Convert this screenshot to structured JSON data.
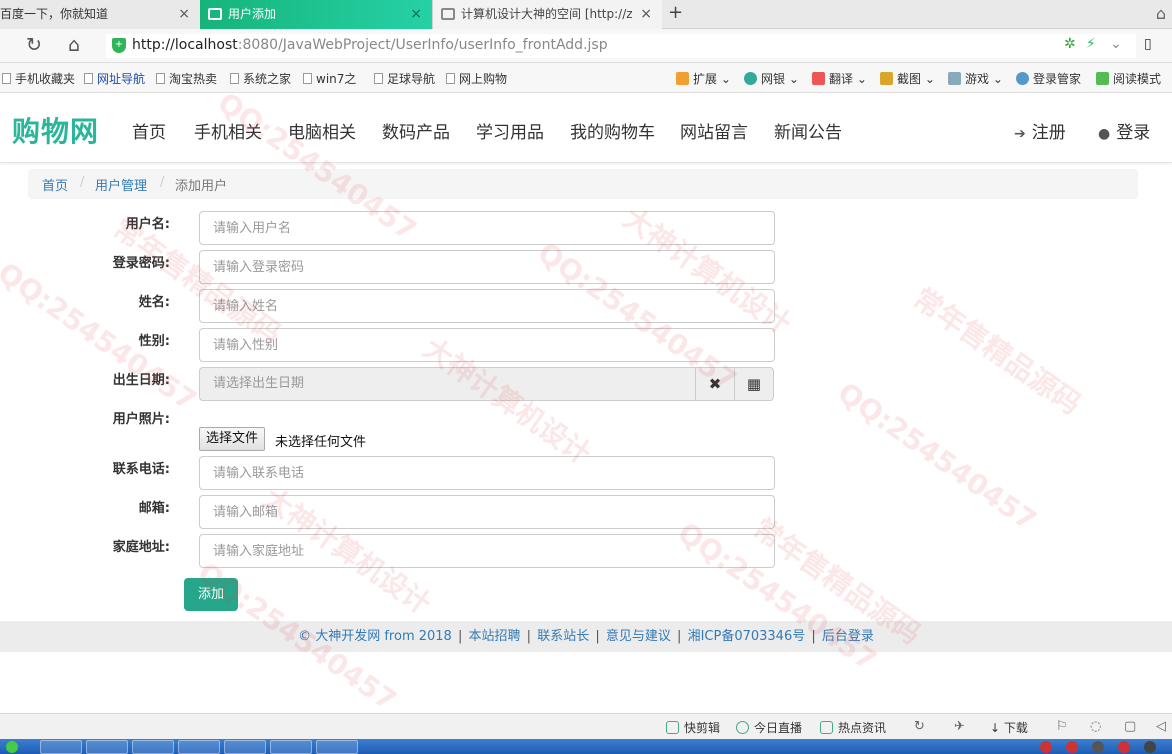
{
  "browser": {
    "tabs": [
      {
        "title": "百度一下，你就知道",
        "close": "×"
      },
      {
        "title": "用户添加",
        "close": "×"
      },
      {
        "title": "计算机设计大神的空间 [http://z",
        "close": "×"
      }
    ],
    "new_tab": "+",
    "url_host": "http://localhost",
    "url_rest": ":8080/JavaWebProject/UserInfo/userInfo_frontAdd.jsp",
    "bookmarks": [
      "手机收藏夹",
      "网址导航",
      "淘宝热卖",
      "系统之家",
      "win7之",
      "足球导航",
      "网上购物"
    ],
    "bookmark_tools": [
      "扩展",
      "网银",
      "翻译",
      "截图",
      "游戏",
      "登录管家",
      "阅读模式"
    ]
  },
  "site": {
    "logo": "购物网",
    "nav": [
      "首页",
      "手机相关",
      "电脑相关",
      "数码产品",
      "学习用品",
      "我的购物车",
      "网站留言",
      "新闻公告"
    ],
    "register": "注册",
    "login": "登录"
  },
  "breadcrumb": {
    "home": "首页",
    "section": "用户管理",
    "current": "添加用户",
    "sep": "/"
  },
  "form": {
    "username": {
      "label": "用户名:",
      "placeholder": "请输入用户名"
    },
    "password": {
      "label": "登录密码:",
      "placeholder": "请输入登录密码"
    },
    "name": {
      "label": "姓名:",
      "placeholder": "请输入姓名"
    },
    "gender": {
      "label": "性别:",
      "placeholder": "请输入性别"
    },
    "birthday": {
      "label": "出生日期:",
      "placeholder": "请选择出生日期",
      "clear": "✖",
      "calendar": "▦"
    },
    "photo": {
      "label": "用户照片:",
      "button": "选择文件",
      "status": "未选择任何文件"
    },
    "phone": {
      "label": "联系电话:",
      "placeholder": "请输入联系电话"
    },
    "email": {
      "label": "邮箱:",
      "placeholder": "请输入邮箱"
    },
    "address": {
      "label": "家庭地址:",
      "placeholder": "请输入家庭地址"
    },
    "submit": "添加"
  },
  "footer": {
    "copyright": "© 大神开发网 from 2018",
    "links": [
      "本站招聘",
      "联系站长",
      "意见与建议",
      "湘ICP备0703346号",
      "后台登录"
    ]
  },
  "statusbar": {
    "items": [
      "快剪辑",
      "今日直播",
      "热点资讯",
      "下载"
    ]
  },
  "watermark": {
    "qq": "QQ:254540457",
    "brand": "大神计算机设计",
    "slogan": "常年售精品源码"
  },
  "colors": {
    "accent": "#26a68a",
    "logo": "#2bb59a",
    "link": "#337ab7",
    "active_tab": "#16b47a"
  }
}
